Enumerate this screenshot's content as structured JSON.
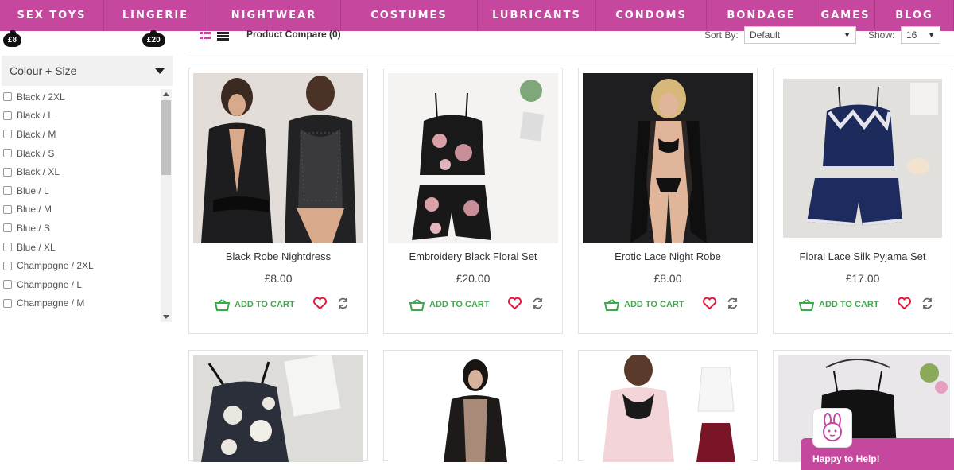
{
  "nav": {
    "items": [
      {
        "label": "SEX TOYS",
        "width": 131
      },
      {
        "label": "LINGERIE",
        "width": 130
      },
      {
        "label": "NIGHTWEAR",
        "width": 168
      },
      {
        "label": "COSTUMES",
        "width": 172
      },
      {
        "label": "LUBRICANTS",
        "width": 149
      },
      {
        "label": "CONDOMS",
        "width": 139
      },
      {
        "label": "BONDAGE",
        "width": 138
      },
      {
        "label": "GAMES",
        "width": 74
      },
      {
        "label": "BLOG",
        "width": 99
      }
    ]
  },
  "price_filter": {
    "min_label": "£8",
    "max_label": "£20"
  },
  "filter": {
    "title": "Colour + Size",
    "options": [
      "Black / 2XL",
      "Black / L",
      "Black / M",
      "Black / S",
      "Black / XL",
      "Blue / L",
      "Blue / M",
      "Blue / S",
      "Blue / XL",
      "Champagne / 2XL",
      "Champagne / L",
      "Champagne / M"
    ]
  },
  "toolbar": {
    "compare_label": "Product Compare (0)",
    "sort_label": "Sort By:",
    "sort_value": "Default",
    "show_label": "Show:",
    "show_value": "16"
  },
  "products": [
    {
      "name": "Black Robe Nightdress",
      "price": "£8.00",
      "cart_label": "ADD TO CART",
      "image": "black-satin-robe"
    },
    {
      "name": "Embroidery Black Floral Set",
      "price": "£20.00",
      "cart_label": "ADD TO CART",
      "image": "black-floral-pyjama"
    },
    {
      "name": "Erotic Lace Night Robe",
      "price": "£8.00",
      "cart_label": "ADD TO CART",
      "image": "sheer-lace-robe"
    },
    {
      "name": "Floral Lace Silk Pyjama Set",
      "price": "£17.00",
      "cart_label": "ADD TO CART",
      "image": "navy-lace-pyjama"
    },
    {
      "name": "",
      "price": "",
      "cart_label": "",
      "image": "floral-satin-chemise"
    },
    {
      "name": "",
      "price": "",
      "cart_label": "",
      "image": "black-lace-robe-model"
    },
    {
      "name": "",
      "price": "",
      "cart_label": "",
      "image": "pink-lace-cami-set"
    },
    {
      "name": "",
      "price": "",
      "cart_label": "",
      "image": "black-satin-cami"
    }
  ],
  "chat": {
    "label": "Happy to Help!"
  },
  "colors": {
    "brand": "#c5479e",
    "cart": "#3ea94a",
    "heart": "#e3183e"
  }
}
